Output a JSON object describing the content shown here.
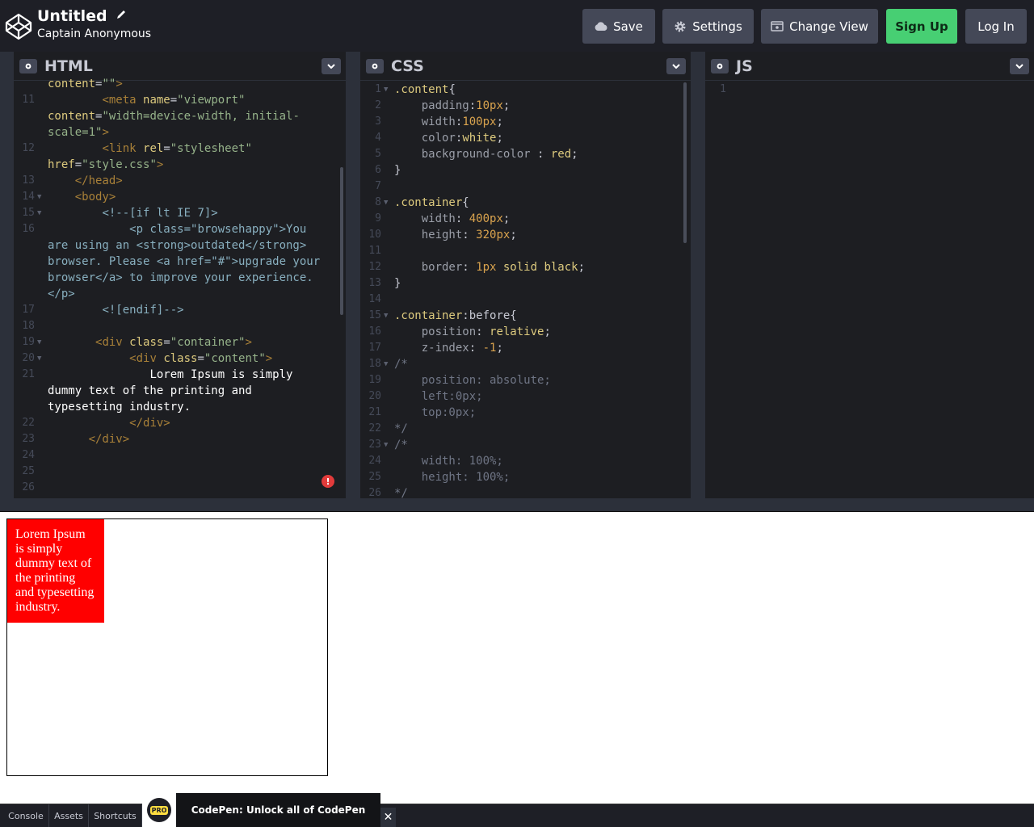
{
  "header": {
    "title": "Untitled",
    "author": "Captain Anonymous",
    "buttons": {
      "save": "Save",
      "settings": "Settings",
      "change_view": "Change View",
      "sign_up": "Sign Up",
      "log_in": "Log In"
    }
  },
  "panes": {
    "html": {
      "title": "HTML",
      "lines": [
        {
          "n": "",
          "fold": false,
          "parts": [
            [
              "t-attr",
              "content"
            ],
            [
              "t-punct",
              "="
            ],
            [
              "t-val",
              "\"\""
            ],
            [
              "t-tag",
              ">"
            ]
          ]
        },
        {
          "n": "11",
          "fold": false,
          "parts": [
            [
              "t-tag",
              "        <meta "
            ],
            [
              "t-attr",
              "name"
            ],
            [
              "t-punct",
              "="
            ],
            [
              "t-val",
              "\"viewport\""
            ],
            [
              "t-punct",
              "\n"
            ],
            [
              "t-attr",
              "content"
            ],
            [
              "t-punct",
              "="
            ],
            [
              "t-val",
              "\"width=device-width, initial-\nscale=1\""
            ],
            [
              "t-tag",
              ">"
            ]
          ]
        },
        {
          "n": "12",
          "fold": false,
          "parts": [
            [
              "t-tag",
              "        <link "
            ],
            [
              "t-attr",
              "rel"
            ],
            [
              "t-punct",
              "="
            ],
            [
              "t-val",
              "\"stylesheet\""
            ],
            [
              "t-punct",
              "\n"
            ],
            [
              "t-attr",
              "href"
            ],
            [
              "t-punct",
              "="
            ],
            [
              "t-val",
              "\"style.css\""
            ],
            [
              "t-tag",
              ">"
            ]
          ]
        },
        {
          "n": "13",
          "fold": false,
          "parts": [
            [
              "t-tag",
              "    </head>"
            ]
          ]
        },
        {
          "n": "14",
          "fold": true,
          "parts": [
            [
              "t-tag",
              "    <body>"
            ]
          ]
        },
        {
          "n": "15",
          "fold": true,
          "parts": [
            [
              "t-com",
              "        <!--[if lt IE 7]>"
            ]
          ]
        },
        {
          "n": "16",
          "fold": false,
          "parts": [
            [
              "t-com",
              "            <p class=\"browsehappy\">You\nare using an <strong>outdated</strong>\nbrowser. Please <a href=\"#\">upgrade your\nbrowser</a> to improve your experience.\n</p>"
            ]
          ]
        },
        {
          "n": "17",
          "fold": false,
          "parts": [
            [
              "t-com",
              "        <![endif]-->"
            ]
          ]
        },
        {
          "n": "18",
          "fold": false,
          "parts": []
        },
        {
          "n": "19",
          "fold": true,
          "parts": [
            [
              "t-tag",
              "       <div "
            ],
            [
              "t-attr",
              "class"
            ],
            [
              "t-punct",
              "="
            ],
            [
              "t-val",
              "\"container\""
            ],
            [
              "t-tag",
              ">"
            ]
          ]
        },
        {
          "n": "20",
          "fold": true,
          "parts": [
            [
              "t-tag",
              "            <div "
            ],
            [
              "t-attr",
              "class"
            ],
            [
              "t-punct",
              "="
            ],
            [
              "t-val",
              "\"content\""
            ],
            [
              "t-tag",
              ">"
            ]
          ]
        },
        {
          "n": "21",
          "fold": false,
          "parts": [
            [
              "t-text",
              "               Lorem Ipsum is simply\ndummy text of the printing and\ntypesetting industry."
            ]
          ]
        },
        {
          "n": "22",
          "fold": false,
          "parts": [
            [
              "t-tag",
              "            </div>"
            ]
          ]
        },
        {
          "n": "23",
          "fold": false,
          "parts": [
            [
              "t-tag",
              "      </div>"
            ]
          ]
        },
        {
          "n": "24",
          "fold": false,
          "parts": []
        },
        {
          "n": "25",
          "fold": false,
          "parts": []
        },
        {
          "n": "26",
          "fold": false,
          "parts": []
        }
      ]
    },
    "css": {
      "title": "CSS",
      "lines": [
        {
          "n": "1",
          "fold": true,
          "parts": [
            [
              "t-sel",
              ".content"
            ],
            [
              "t-punct",
              "{"
            ]
          ]
        },
        {
          "n": "2",
          "fold": false,
          "parts": [
            [
              "t-prop",
              "    padding"
            ],
            [
              "t-punct",
              ":"
            ],
            [
              "t-num",
              "10px"
            ],
            [
              "t-punct",
              ";"
            ]
          ]
        },
        {
          "n": "3",
          "fold": false,
          "parts": [
            [
              "t-prop",
              "    width"
            ],
            [
              "t-punct",
              ":"
            ],
            [
              "t-num",
              "100px"
            ],
            [
              "t-punct",
              ";"
            ]
          ]
        },
        {
          "n": "4",
          "fold": false,
          "parts": [
            [
              "t-prop",
              "    color"
            ],
            [
              "t-punct",
              ":"
            ],
            [
              "t-kw",
              "white"
            ],
            [
              "t-punct",
              ";"
            ]
          ]
        },
        {
          "n": "5",
          "fold": false,
          "parts": [
            [
              "t-prop",
              "    background-color "
            ],
            [
              "t-punct",
              ": "
            ],
            [
              "t-kw",
              "red"
            ],
            [
              "t-punct",
              ";"
            ]
          ]
        },
        {
          "n": "6",
          "fold": false,
          "parts": [
            [
              "t-punct",
              "}"
            ]
          ]
        },
        {
          "n": "7",
          "fold": false,
          "parts": []
        },
        {
          "n": "8",
          "fold": true,
          "parts": [
            [
              "t-sel",
              ".container"
            ],
            [
              "t-punct",
              "{"
            ]
          ]
        },
        {
          "n": "9",
          "fold": false,
          "parts": [
            [
              "t-prop",
              "    width"
            ],
            [
              "t-punct",
              ": "
            ],
            [
              "t-num",
              "400px"
            ],
            [
              "t-punct",
              ";"
            ]
          ]
        },
        {
          "n": "10",
          "fold": false,
          "parts": [
            [
              "t-prop",
              "    height"
            ],
            [
              "t-punct",
              ": "
            ],
            [
              "t-num",
              "320px"
            ],
            [
              "t-punct",
              ";"
            ]
          ]
        },
        {
          "n": "11",
          "fold": false,
          "parts": []
        },
        {
          "n": "12",
          "fold": false,
          "parts": [
            [
              "t-prop",
              "    border"
            ],
            [
              "t-punct",
              ": "
            ],
            [
              "t-num",
              "1px"
            ],
            [
              "t-kw",
              " solid black"
            ],
            [
              "t-punct",
              ";"
            ]
          ]
        },
        {
          "n": "13",
          "fold": false,
          "parts": [
            [
              "t-punct",
              "}"
            ]
          ]
        },
        {
          "n": "14",
          "fold": false,
          "parts": []
        },
        {
          "n": "15",
          "fold": true,
          "parts": [
            [
              "t-sel",
              ".container"
            ],
            [
              "t-punct",
              ":before{"
            ]
          ]
        },
        {
          "n": "16",
          "fold": false,
          "parts": [
            [
              "t-prop",
              "    position"
            ],
            [
              "t-punct",
              ": "
            ],
            [
              "t-kw",
              "relative"
            ],
            [
              "t-punct",
              ";"
            ]
          ]
        },
        {
          "n": "17",
          "fold": false,
          "parts": [
            [
              "t-prop",
              "    z-index"
            ],
            [
              "t-punct",
              ": "
            ],
            [
              "t-num",
              "-1"
            ],
            [
              "t-punct",
              ";"
            ]
          ]
        },
        {
          "n": "18",
          "fold": true,
          "parts": [
            [
              "t-csscom",
              "/*"
            ]
          ]
        },
        {
          "n": "19",
          "fold": false,
          "parts": [
            [
              "t-csscom",
              "    position: absolute;"
            ]
          ]
        },
        {
          "n": "20",
          "fold": false,
          "parts": [
            [
              "t-csscom",
              "    left:0px;"
            ]
          ]
        },
        {
          "n": "21",
          "fold": false,
          "parts": [
            [
              "t-csscom",
              "    top:0px;"
            ]
          ]
        },
        {
          "n": "22",
          "fold": false,
          "parts": [
            [
              "t-csscom",
              "*/"
            ]
          ]
        },
        {
          "n": "23",
          "fold": true,
          "parts": [
            [
              "t-csscom",
              "/*"
            ]
          ]
        },
        {
          "n": "24",
          "fold": false,
          "parts": [
            [
              "t-csscom",
              "    width: 100%;"
            ]
          ]
        },
        {
          "n": "25",
          "fold": false,
          "parts": [
            [
              "t-csscom",
              "    height: 100%;"
            ]
          ]
        },
        {
          "n": "26",
          "fold": false,
          "parts": [
            [
              "t-csscom",
              "*/"
            ]
          ]
        }
      ]
    },
    "js": {
      "title": "JS",
      "lines": [
        {
          "n": "1",
          "fold": false,
          "parts": []
        }
      ]
    }
  },
  "preview": {
    "content_text": "Lorem Ipsum is simply dummy text of the printing and typesetting industry."
  },
  "footer": {
    "console": "Console",
    "assets": "Assets",
    "shortcuts": "Shortcuts",
    "promo_badge": "PRO",
    "promo_text": "CodePen: Unlock all of CodePen",
    "close": "✕"
  },
  "error_badge": "!",
  "colors": {
    "header_bg": "#1e1f26",
    "button_bg": "#444857",
    "signup_bg": "#47cf73",
    "preview_box": "#ff0000"
  }
}
